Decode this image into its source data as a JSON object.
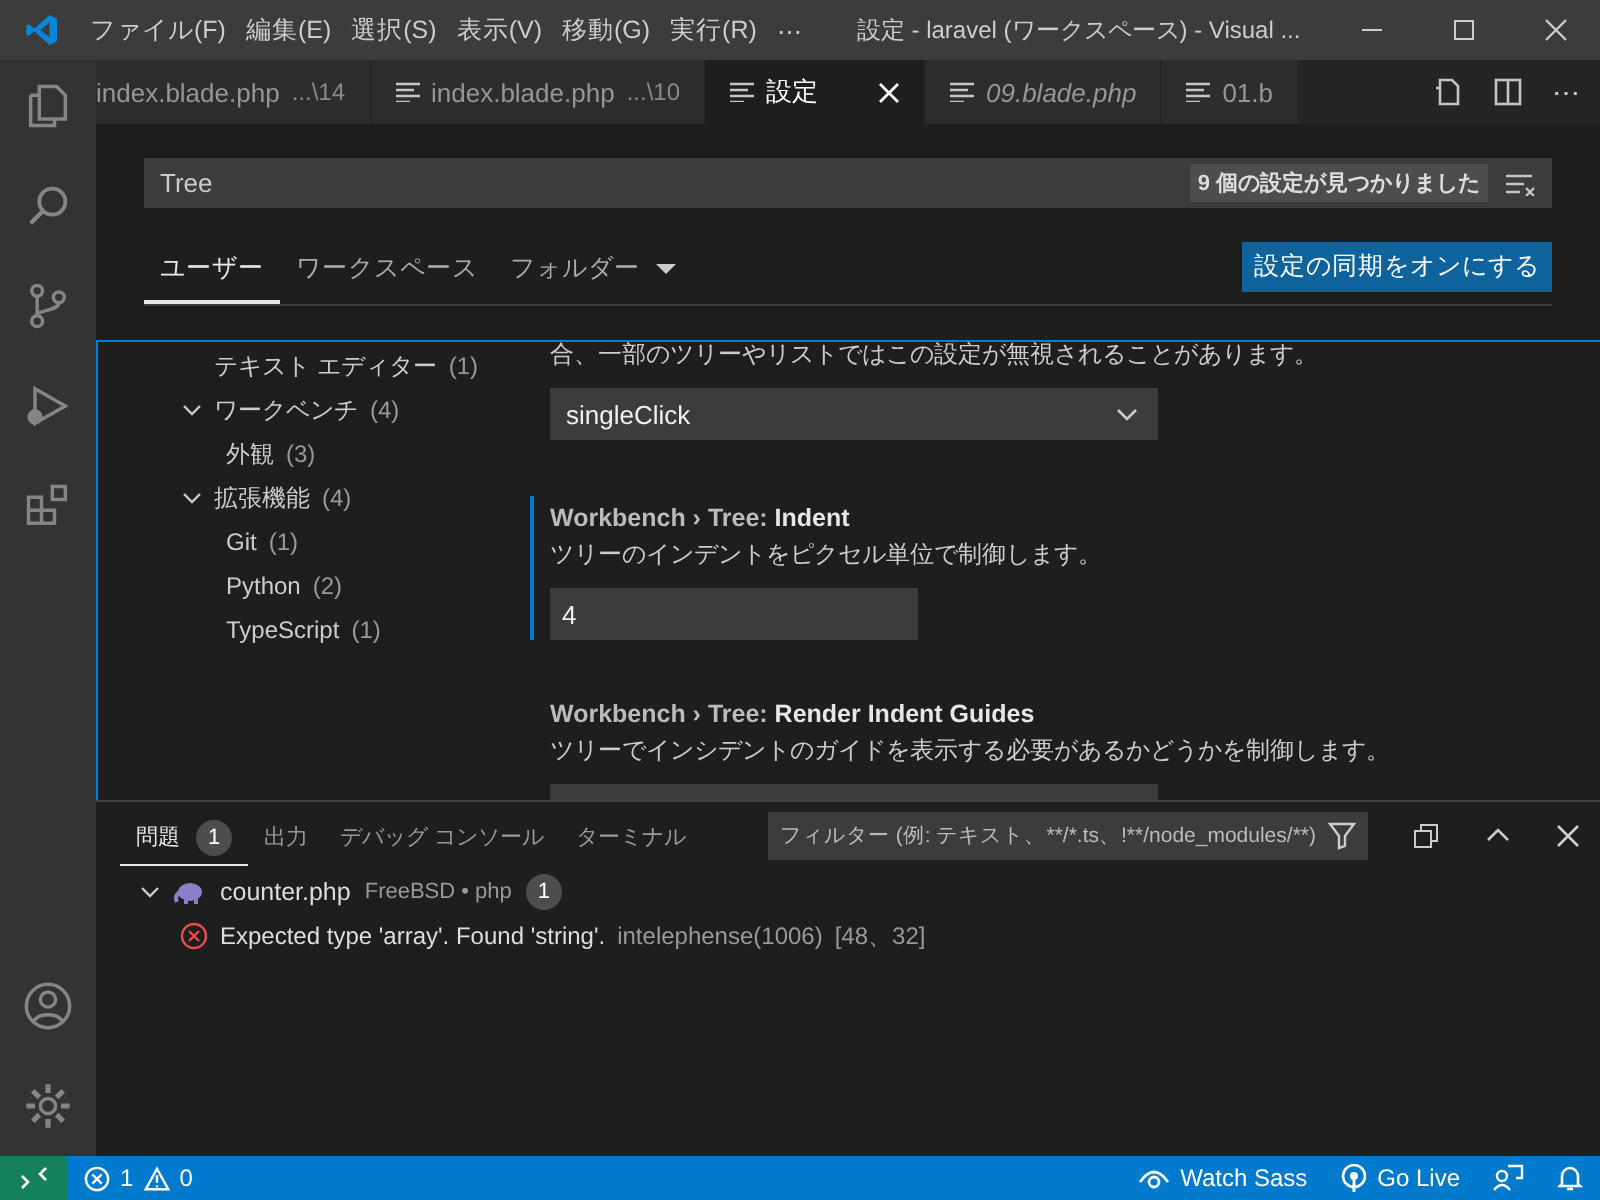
{
  "title_bar": {
    "menu": [
      "ファイル(F)",
      "編集(E)",
      "選択(S)",
      "表示(V)",
      "移動(G)",
      "実行(R)"
    ],
    "more": "⋯",
    "title": "設定 - laravel (ワークスペース) - Visual ..."
  },
  "tabs": [
    {
      "label": "index.blade.php",
      "path": "...\\14",
      "preview": false,
      "icon": false,
      "selected": false
    },
    {
      "label": "index.blade.php",
      "path": "...\\10",
      "preview": false,
      "icon": true,
      "selected": false
    },
    {
      "label": "設定",
      "preview": false,
      "icon": true,
      "selected": true
    },
    {
      "label": "09.blade.php",
      "preview": true,
      "icon": true,
      "selected": false
    },
    {
      "label": "01.b",
      "preview": false,
      "icon": true,
      "selected": false
    }
  ],
  "editor_actions": {
    "more": "⋯"
  },
  "settings": {
    "search": {
      "value": "Tree",
      "result_count": "9 個の設定が見つかりました"
    },
    "scopes": [
      {
        "label": "ユーザー",
        "selected": true
      },
      {
        "label": "ワークスペース",
        "selected": false
      },
      {
        "label": "フォルダー",
        "selected": false,
        "dropdown": true
      }
    ],
    "sync_button": "設定の同期をオンにする",
    "toc": [
      {
        "label": "テキスト エディター",
        "count": "(1)"
      },
      {
        "label": "ワークベンチ",
        "count": "(4)",
        "expanded": true,
        "children": [
          {
            "label": "外観",
            "count": "(3)"
          }
        ]
      },
      {
        "label": "拡張機能",
        "count": "(4)",
        "expanded": true,
        "children": [
          {
            "label": "Git",
            "count": "(1)"
          },
          {
            "label": "Python",
            "count": "(2)"
          },
          {
            "label": "TypeScript",
            "count": "(1)"
          }
        ]
      }
    ],
    "items": [
      {
        "kind": "dropdown",
        "description": "合、一部のツリーやリストではこの設定が無視されることがあります。",
        "value": "singleClick",
        "focused": false
      },
      {
        "kind": "number",
        "category": "Workbench › Tree: ",
        "name": "Indent",
        "description": "ツリーのインデントをピクセル単位で制御します。",
        "value": "4",
        "focused": true
      },
      {
        "kind": "dropdown",
        "category": "Workbench › Tree: ",
        "name": "Render Indent Guides",
        "description": "ツリーでインシデントのガイドを表示する必要があるかどうかを制御します。",
        "focused": false
      }
    ]
  },
  "panel": {
    "tabs": [
      {
        "label": "問題",
        "badge": "1",
        "selected": true
      },
      {
        "label": "出力",
        "selected": false
      },
      {
        "label": "デバッグ コンソール",
        "selected": false
      },
      {
        "label": "ターミナル",
        "selected": false
      }
    ],
    "filter": {
      "placeholder": "フィルター (例: テキスト、**/*.ts、!**/node_modules/**)"
    },
    "problems": [
      {
        "file": "counter.php",
        "path": "FreeBSD • php",
        "count": "1",
        "expanded": true,
        "items": [
          {
            "message": "Expected type 'array'. Found 'string'.",
            "source": "intelephense(1006)",
            "location": "[48、32]"
          }
        ]
      }
    ]
  },
  "status_bar": {
    "errors": "1",
    "warnings": "0",
    "right": [
      {
        "kind": "eye",
        "label": "Watch Sass"
      },
      {
        "kind": "broadcast",
        "label": "Go Live"
      },
      {
        "kind": "feedback"
      },
      {
        "kind": "bell"
      }
    ]
  }
}
